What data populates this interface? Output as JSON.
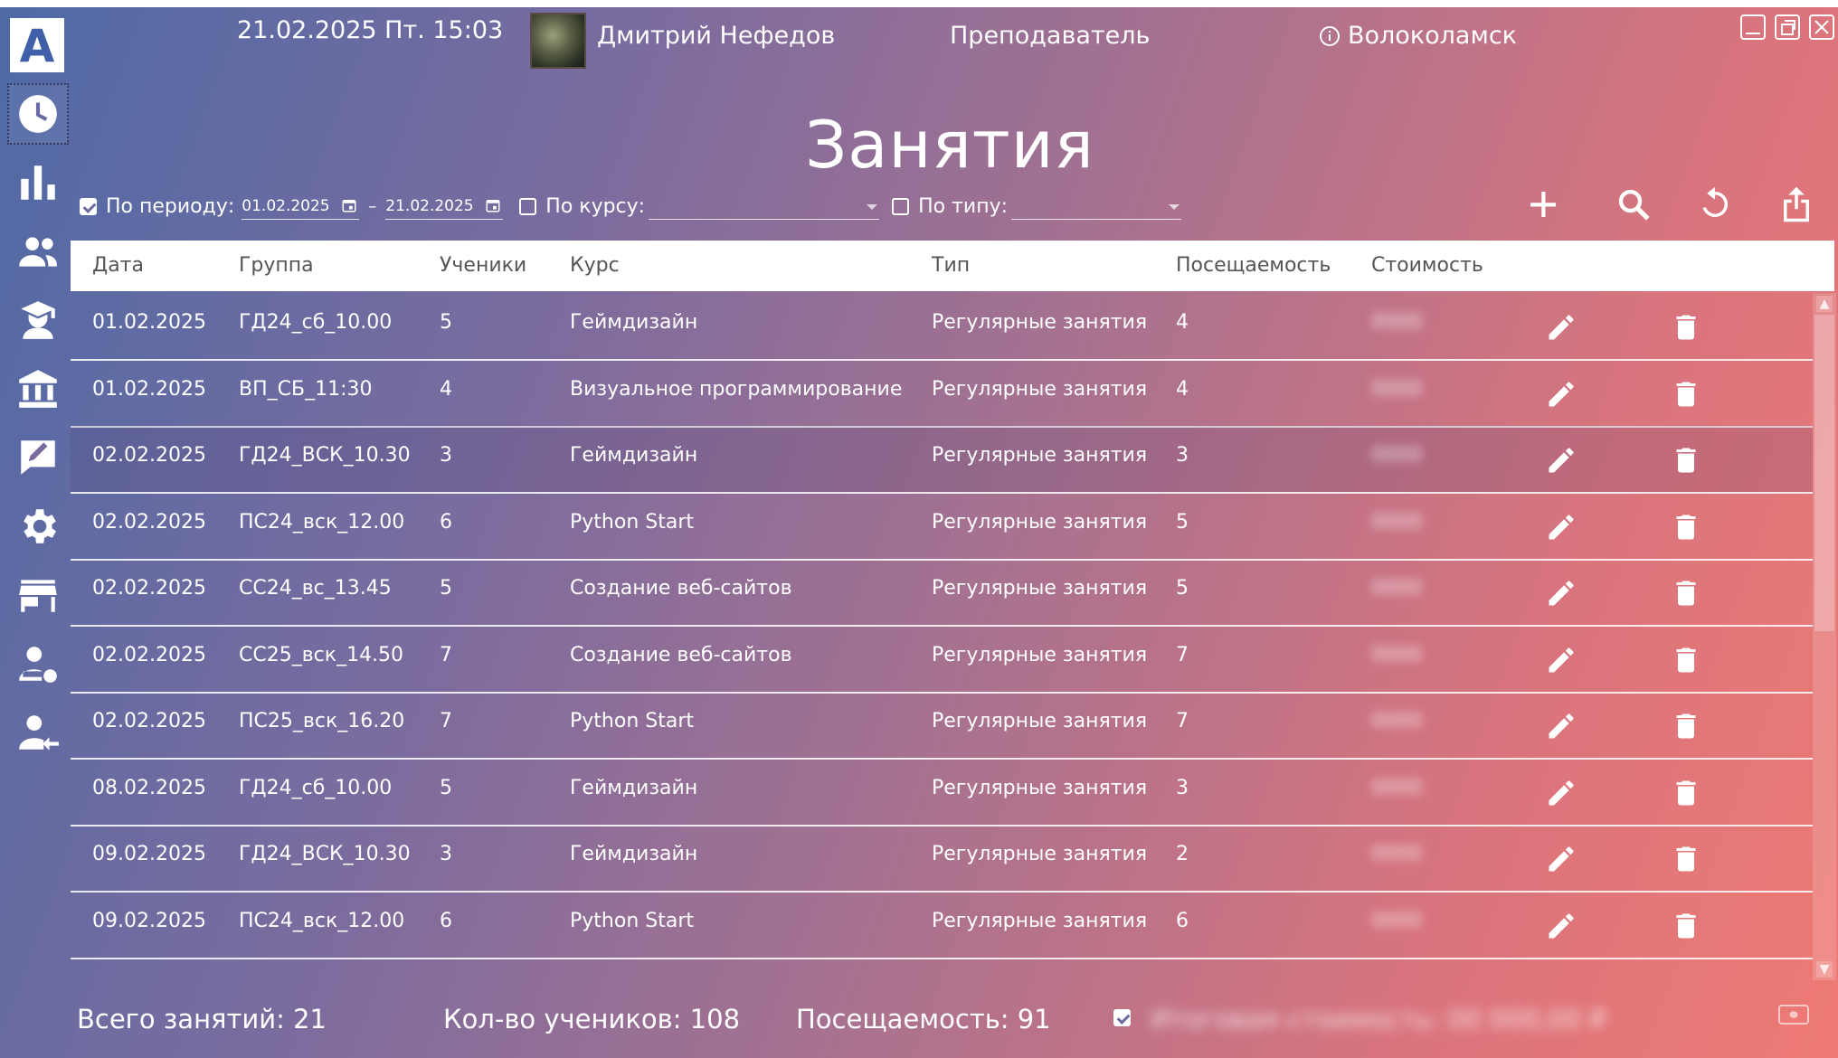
{
  "header": {
    "datetime": "21.02.2025 Пт. 15:03",
    "user_name": "Дмитрий Нефедов",
    "role": "Преподаватель",
    "location": "Волоколамск",
    "logo_letter": "A"
  },
  "page_title": "Занятия",
  "filters": {
    "period_label": "По периоду:",
    "period_checked": true,
    "date_from": "01.02.2025",
    "date_sep": "–",
    "date_to": "21.02.2025",
    "course_label": "По курсу:",
    "course_checked": false,
    "course_value": "",
    "type_label": "По типу:",
    "type_checked": false,
    "type_value": ""
  },
  "table": {
    "columns": [
      "Дата",
      "Группа",
      "Ученики",
      "Курс",
      "Тип",
      "Посещаемость",
      "Стоимость"
    ],
    "rows": [
      {
        "date": "01.02.2025",
        "group": "ГД24_сб_10.00",
        "students": "5",
        "course": "Геймдизайн",
        "type": "Регулярные занятия",
        "attendance": "4",
        "cost": "0000"
      },
      {
        "date": "01.02.2025",
        "group": "ВП_СБ_11:30",
        "students": "4",
        "course": "Визуальное программирование",
        "type": "Регулярные занятия",
        "attendance": "4",
        "cost": "0000"
      },
      {
        "date": "02.02.2025",
        "group": "ГД24_ВСК_10.30",
        "students": "3",
        "course": "Геймдизайн",
        "type": "Регулярные занятия",
        "attendance": "3",
        "cost": "0000"
      },
      {
        "date": "02.02.2025",
        "group": "ПС24_вск_12.00",
        "students": "6",
        "course": "Python Start",
        "type": "Регулярные занятия",
        "attendance": "5",
        "cost": "0000"
      },
      {
        "date": "02.02.2025",
        "group": "СС24_вс_13.45",
        "students": "5",
        "course": "Создание веб-сайтов",
        "type": "Регулярные занятия",
        "attendance": "5",
        "cost": "0000"
      },
      {
        "date": "02.02.2025",
        "group": "СС25_вск_14.50",
        "students": "7",
        "course": "Создание веб-сайтов",
        "type": "Регулярные занятия",
        "attendance": "7",
        "cost": "0000"
      },
      {
        "date": "02.02.2025",
        "group": "ПС25_вск_16.20",
        "students": "7",
        "course": "Python Start",
        "type": "Регулярные занятия",
        "attendance": "7",
        "cost": "0000"
      },
      {
        "date": "08.02.2025",
        "group": "ГД24_сб_10.00",
        "students": "5",
        "course": "Геймдизайн",
        "type": "Регулярные занятия",
        "attendance": "3",
        "cost": "0000"
      },
      {
        "date": "09.02.2025",
        "group": "ГД24_ВСК_10.30",
        "students": "3",
        "course": "Геймдизайн",
        "type": "Регулярные занятия",
        "attendance": "2",
        "cost": "0000"
      },
      {
        "date": "09.02.2025",
        "group": "ПС24_вск_12.00",
        "students": "6",
        "course": "Python Start",
        "type": "Регулярные занятия",
        "attendance": "6",
        "cost": "0000"
      }
    ]
  },
  "footer": {
    "total_lessons": "Всего занятий: 21",
    "students_count": "Кол-во учеников: 108",
    "attendance": "Посещаемость: 91",
    "total_cost_checked": true,
    "total_cost": "Итоговая стоимость: 00 000,00 ₽"
  },
  "sidebar": {
    "items": [
      "schedule-icon",
      "statistics-icon",
      "groups-icon",
      "students-icon",
      "institution-icon",
      "notes-icon",
      "settings-icon",
      "store-icon",
      "user-settings-icon",
      "user-leave-icon"
    ]
  }
}
